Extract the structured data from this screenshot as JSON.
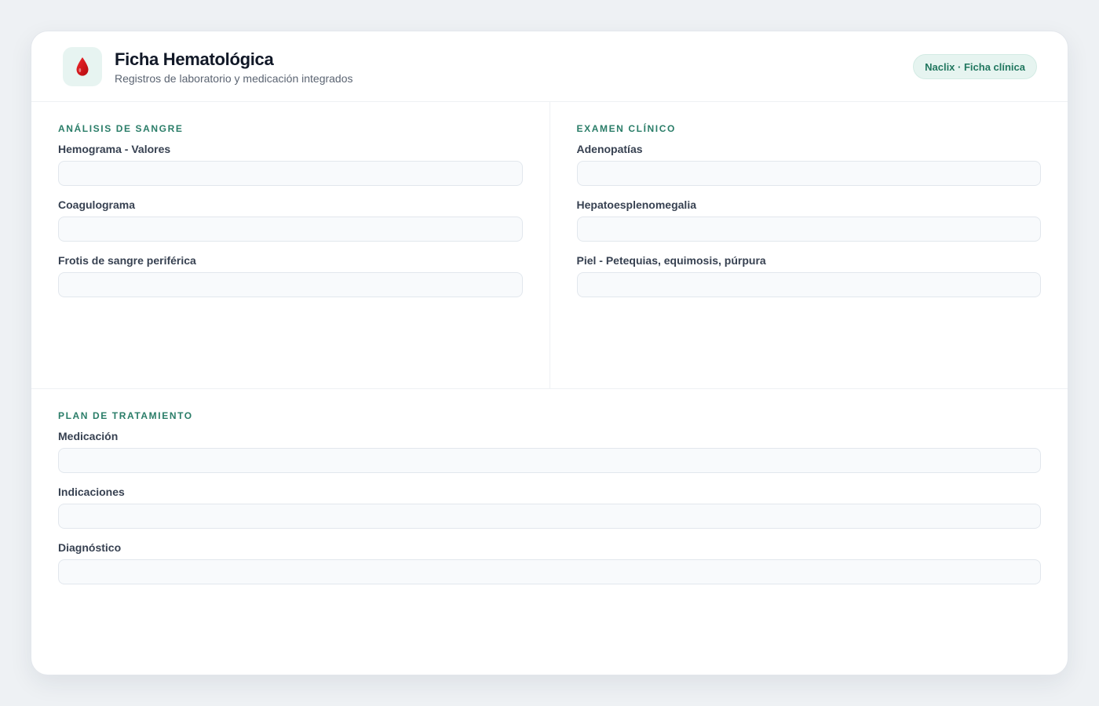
{
  "header": {
    "title": "Ficha Hematológica",
    "subtitle": "Registros de laboratorio y medicación integrados",
    "badge": "Naclix · Ficha clínica",
    "logo_icon": "blood-drop-icon"
  },
  "sections": {
    "analisis": {
      "title": "Análisis de sangre",
      "fields": [
        {
          "label": "Hemograma - Valores",
          "value": ""
        },
        {
          "label": "Coagulograma",
          "value": ""
        },
        {
          "label": "Frotis de sangre periférica",
          "value": ""
        }
      ]
    },
    "examen": {
      "title": "Examen clínico",
      "fields": [
        {
          "label": "Adenopatías",
          "value": ""
        },
        {
          "label": "Hepatoesplenomegalia",
          "value": ""
        },
        {
          "label": "Piel - Petequias, equimosis, púrpura",
          "value": ""
        }
      ]
    },
    "plan": {
      "title": "Plan de tratamiento",
      "fields": [
        {
          "label": "Medicación",
          "value": ""
        },
        {
          "label": "Indicaciones",
          "value": ""
        },
        {
          "label": "Diagnóstico",
          "value": ""
        }
      ]
    }
  },
  "colors": {
    "accent": "#2a7d68",
    "drop": "#d40f14",
    "page_bg": "#eef1f4"
  }
}
